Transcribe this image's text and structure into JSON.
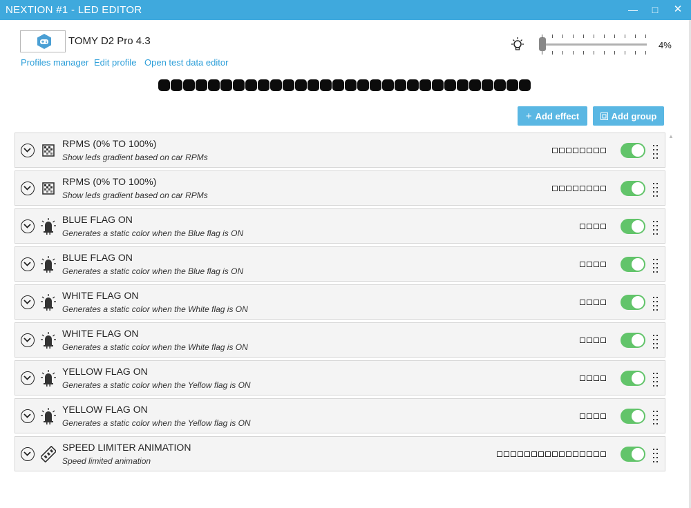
{
  "window": {
    "title": "NEXTION #1 - LED EDITOR",
    "minimize_label": "―",
    "maximize_label": "□",
    "close_label": "✕"
  },
  "profile": {
    "name": "TOMY D2 Pro 4.3",
    "icon": "gamepad-hexagon-icon"
  },
  "links": {
    "profiles_manager": "Profiles manager",
    "edit_profile": "Edit profile",
    "open_test_data_editor": "Open test data editor"
  },
  "brightness": {
    "icon": "lightbulb-icon",
    "value_label": "4%",
    "value": 0.04,
    "tick_count": 11
  },
  "led_preview": {
    "count": 30,
    "color": "#0c0c0c"
  },
  "toolbar": {
    "add_effect_label": "Add effect",
    "add_group_label": "Add group",
    "add_effect_icon": "plus-icon",
    "add_group_icon": "group-icon",
    "button_color": "#5ab7e3"
  },
  "effects": [
    {
      "title": "RPMS (0% TO 100%)",
      "description": "Show leds gradient based on car RPMs",
      "icon": "gradient-icon",
      "led_count": 8,
      "enabled": true
    },
    {
      "title": "RPMS (0% TO 100%)",
      "description": "Show leds gradient based on car RPMs",
      "icon": "gradient-icon",
      "led_count": 8,
      "enabled": true
    },
    {
      "title": "BLUE FLAG ON",
      "description": "Generates a static color when the Blue flag is ON",
      "icon": "led-light-icon",
      "led_count": 4,
      "enabled": true
    },
    {
      "title": "BLUE FLAG ON",
      "description": "Generates a static color when the Blue flag is ON",
      "icon": "led-light-icon",
      "led_count": 4,
      "enabled": true
    },
    {
      "title": "WHITE FLAG ON",
      "description": "Generates a static color when the White flag is ON",
      "icon": "led-light-icon",
      "led_count": 4,
      "enabled": true
    },
    {
      "title": "WHITE FLAG ON",
      "description": "Generates a static color when the White flag is ON",
      "icon": "led-light-icon",
      "led_count": 4,
      "enabled": true
    },
    {
      "title": "YELLOW FLAG ON",
      "description": "Generates a static color when the Yellow flag is ON",
      "icon": "led-light-icon",
      "led_count": 4,
      "enabled": true
    },
    {
      "title": "YELLOW FLAG ON",
      "description": "Generates a static color when the Yellow flag is ON",
      "icon": "led-light-icon",
      "led_count": 4,
      "enabled": true
    },
    {
      "title": "SPEED LIMITER ANIMATION",
      "description": "Speed limited animation",
      "icon": "led-strip-icon",
      "led_count": 16,
      "enabled": true
    }
  ],
  "colors": {
    "titlebar": "#3fa9dd",
    "link": "#2d9fd9",
    "toggle_on": "#62c46a"
  }
}
